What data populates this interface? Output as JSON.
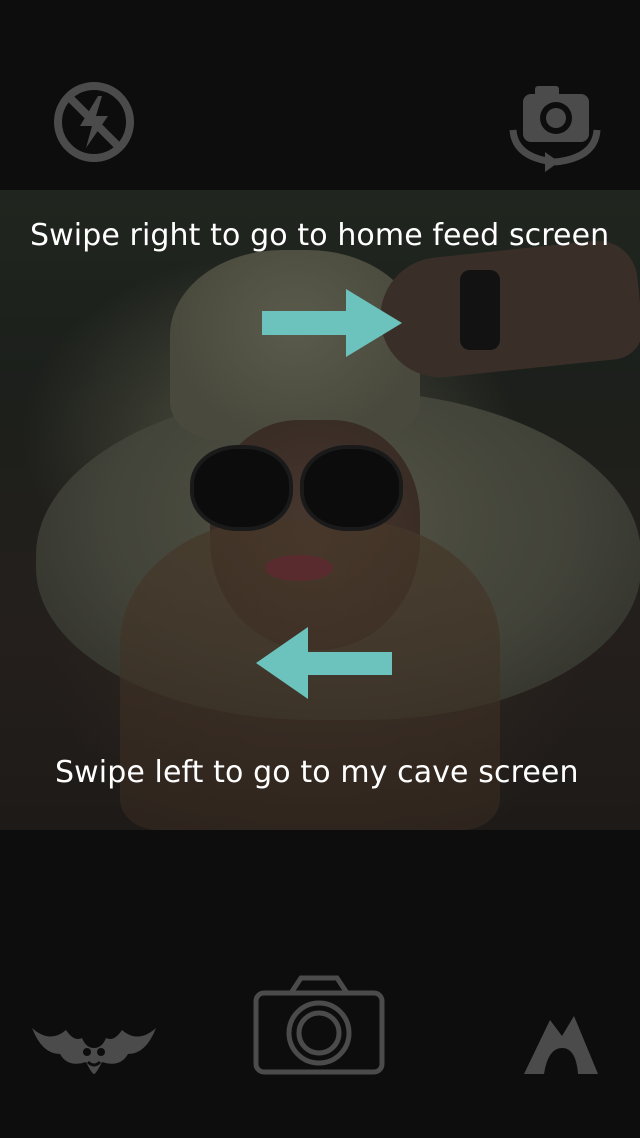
{
  "hints": {
    "swipe_right": "Swipe right to go to home feed screen",
    "swipe_left": "Swipe left to go to my cave screen"
  },
  "icons": {
    "flash": "flash-off-icon",
    "switch_camera": "switch-camera-icon",
    "capture": "camera-icon",
    "bat": "bat-icon",
    "cave": "cave-icon",
    "arrow_right": "arrow-right-icon",
    "arrow_left": "arrow-left-icon"
  },
  "colors": {
    "arrow": "#6cc3bd",
    "icon": "#4b4b4b",
    "text": "#ffffff"
  }
}
